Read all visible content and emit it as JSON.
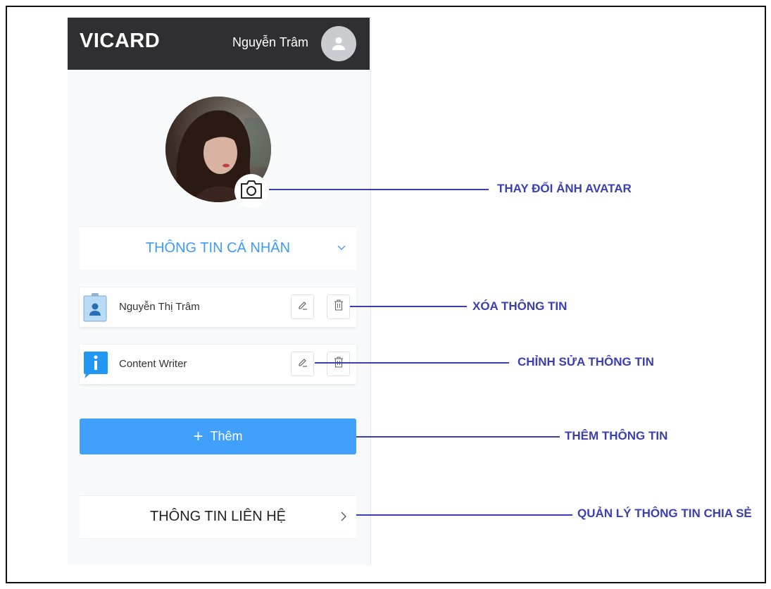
{
  "header": {
    "brand": "VICARD",
    "username": "Nguyễn Trâm"
  },
  "icons": {
    "user": "user-avatar-icon",
    "camera": "camera-icon",
    "edit": "pencil-icon",
    "delete": "trash-icon",
    "id_card": "id-card-icon",
    "info": "info-icon"
  },
  "sections": {
    "personal": {
      "title": "THÔNG TIN CÁ NHÂN"
    },
    "contact": {
      "title": "THÔNG TIN LIÊN HỆ"
    }
  },
  "cards": [
    {
      "text": "Nguyễn Thị Trâm"
    },
    {
      "text": "Content Writer"
    }
  ],
  "add_button": {
    "label": "Thêm"
  },
  "callouts": {
    "change_avatar": "THAY ĐỔI ẢNH AVATAR",
    "delete_info": "XÓA THÔNG TIN",
    "edit_info": "CHỈNH SỬA THÔNG TIN",
    "add_info": "THÊM THÔNG TIN",
    "manage_share": "QUẢN LÝ THÔNG TIN CHIA SẺ"
  },
  "colors": {
    "accent": "#41a0fb",
    "header_bg": "#2f2f31",
    "callout": "#3b3fb0",
    "section_title": "#3d9bf3"
  }
}
